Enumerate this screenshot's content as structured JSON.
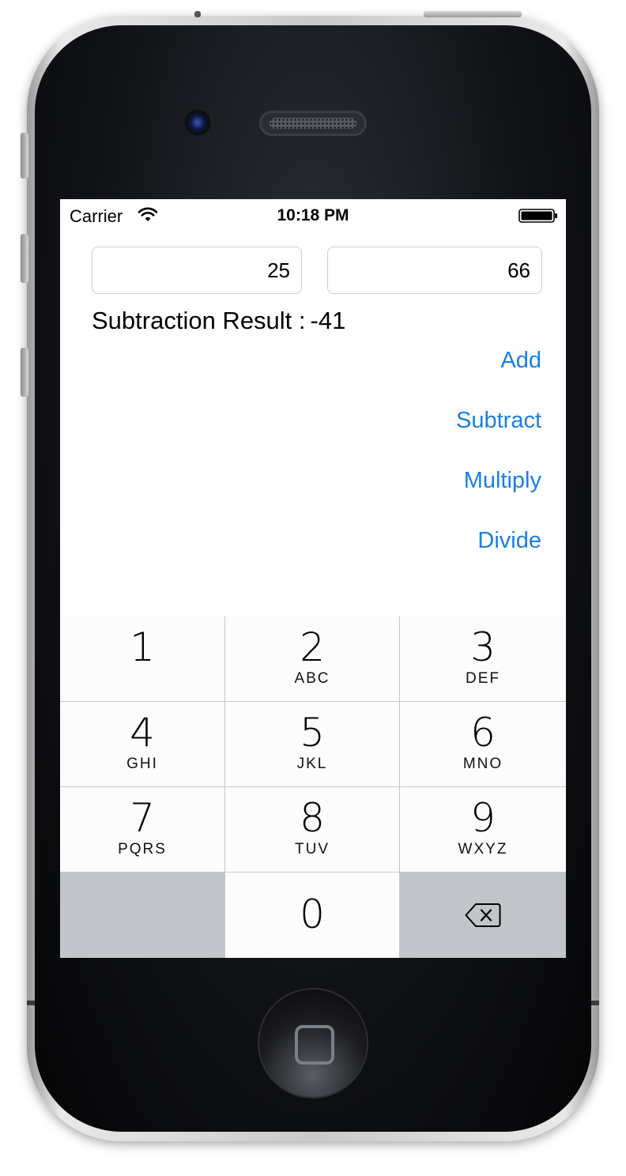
{
  "status_bar": {
    "carrier": "Carrier",
    "time": "10:18 PM"
  },
  "inputs": {
    "first_value": "25",
    "second_value": "66"
  },
  "result": {
    "label": "Subtraction Result :",
    "value": "-41"
  },
  "operations": {
    "add": "Add",
    "subtract": "Subtract",
    "multiply": "Multiply",
    "divide": "Divide"
  },
  "keypad": {
    "keys": [
      {
        "digit": "1",
        "letters": ""
      },
      {
        "digit": "2",
        "letters": "ABC"
      },
      {
        "digit": "3",
        "letters": "DEF"
      },
      {
        "digit": "4",
        "letters": "GHI"
      },
      {
        "digit": "5",
        "letters": "JKL"
      },
      {
        "digit": "6",
        "letters": "MNO"
      },
      {
        "digit": "7",
        "letters": "PQRS"
      },
      {
        "digit": "8",
        "letters": "TUV"
      },
      {
        "digit": "9",
        "letters": "WXYZ"
      },
      {
        "digit": "0",
        "letters": ""
      }
    ],
    "delete_icon": "delete-backspace-icon"
  },
  "colors": {
    "accent": "#1a7fe6",
    "keypad_special": "#c2c5c9"
  }
}
